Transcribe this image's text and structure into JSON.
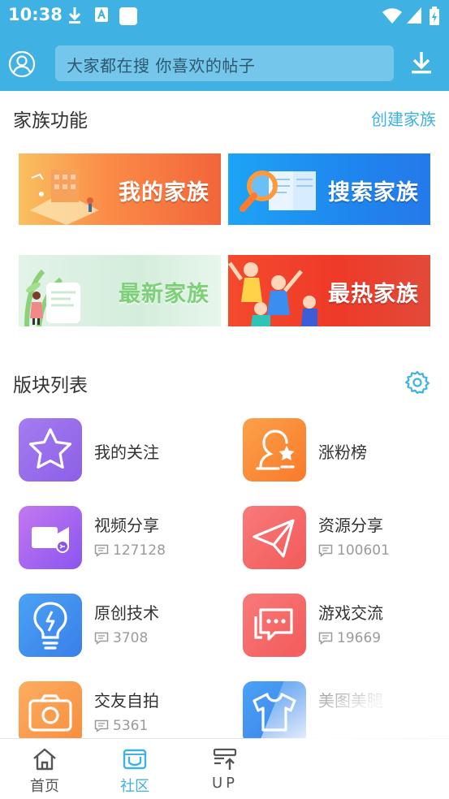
{
  "status_bar": {
    "time": "10:38"
  },
  "header": {
    "search_placeholder": "大家都在搜  你喜欢的帖子"
  },
  "family": {
    "title": "家族功能",
    "create_link": "创建家族",
    "banners": [
      {
        "label": "我的家族"
      },
      {
        "label": "搜索家族"
      },
      {
        "label": "最新家族"
      },
      {
        "label": "最热家族"
      }
    ]
  },
  "boards": {
    "title": "版块列表",
    "items": [
      {
        "name": "我的关注",
        "icon": "star-icon",
        "color": "#9a6ee9"
      },
      {
        "name": "涨粉榜",
        "icon": "user-rank-icon",
        "color": "#fb8a35"
      },
      {
        "name": "视频分享",
        "count": "127128",
        "icon": "video-icon",
        "color": "#9a5df0"
      },
      {
        "name": "资源分享",
        "count": "100601",
        "icon": "paper-plane-icon",
        "color": "#f46b6b"
      },
      {
        "name": "原创技术",
        "count": "3708",
        "icon": "lightbulb-icon",
        "color": "#3e8ef0"
      },
      {
        "name": "游戏交流",
        "count": "19669",
        "icon": "chat-bubble-icon",
        "color": "#f46b6b"
      },
      {
        "name": "交友自拍",
        "count": "5361",
        "icon": "camera-icon",
        "color": "#fb9a52"
      },
      {
        "name": "美图美腿",
        "icon": "tshirt-icon",
        "color": "#3e8ef0"
      }
    ]
  },
  "bottom_nav": [
    {
      "label": "首页",
      "icon": "home-icon",
      "active": false
    },
    {
      "label": "社区",
      "icon": "community-icon",
      "active": true
    },
    {
      "label": "UP",
      "icon": "upload-icon",
      "active": false
    }
  ],
  "colors": {
    "primary": "#3fb1e3",
    "text": "#333333",
    "muted": "#9a9a9a"
  }
}
